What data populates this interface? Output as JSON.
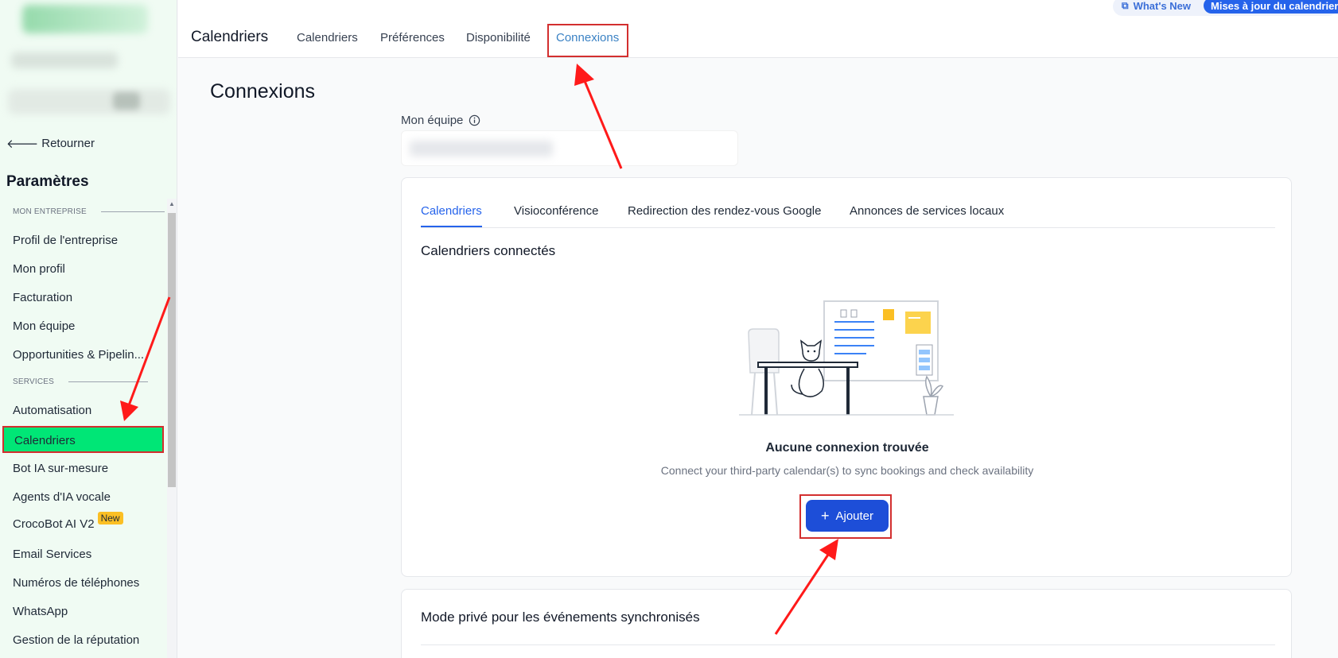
{
  "sidebar": {
    "back_label": "Retourner",
    "title": "Paramètres",
    "sections": [
      {
        "label": "MON ENTREPRISE"
      },
      {
        "label": "SERVICES"
      }
    ],
    "items": [
      {
        "label": "Profil de l'entreprise"
      },
      {
        "label": "Mon profil"
      },
      {
        "label": "Facturation"
      },
      {
        "label": "Mon équipe"
      },
      {
        "label": "Opportunities & Pipelin..."
      },
      {
        "label": "Automatisation"
      },
      {
        "label": "Calendriers"
      },
      {
        "label": "Bot IA sur-mesure"
      },
      {
        "label": "Agents d'IA vocale"
      },
      {
        "label": "CrocoBot AI V2",
        "badge": "New"
      },
      {
        "label": "Email Services"
      },
      {
        "label": "Numéros de téléphones"
      },
      {
        "label": "WhatsApp"
      },
      {
        "label": "Gestion de la réputation"
      }
    ],
    "active_item": "Calendriers",
    "active_color": "#00e676"
  },
  "header": {
    "title": "Calendriers",
    "tabs": [
      {
        "label": "Calendriers"
      },
      {
        "label": "Préférences"
      },
      {
        "label": "Disponibilité"
      },
      {
        "label": "Connexions"
      }
    ],
    "active_tab": "Connexions",
    "whats_new_label": "What's New",
    "updates_label": "Mises à jour du calendrier"
  },
  "main": {
    "page_title": "Connexions",
    "team_label": "Mon équipe",
    "tabs": [
      {
        "label": "Calendriers"
      },
      {
        "label": "Visioconférence"
      },
      {
        "label": "Redirection des rendez-vous Google"
      },
      {
        "label": "Annonces de services locaux"
      }
    ],
    "active_tab": "Calendriers",
    "section_title": "Calendriers connectés",
    "empty_title": "Aucune connexion trouvée",
    "empty_subtitle": "Connect your third-party calendar(s) to sync bookings and check availability",
    "add_button_label": "Ajouter",
    "private_mode_title": "Mode privé pour les événements synchronisés"
  },
  "colors": {
    "primary": "#2563eb",
    "annotation_red": "#d32f2f",
    "active_tab_text": "#3b82c4"
  }
}
